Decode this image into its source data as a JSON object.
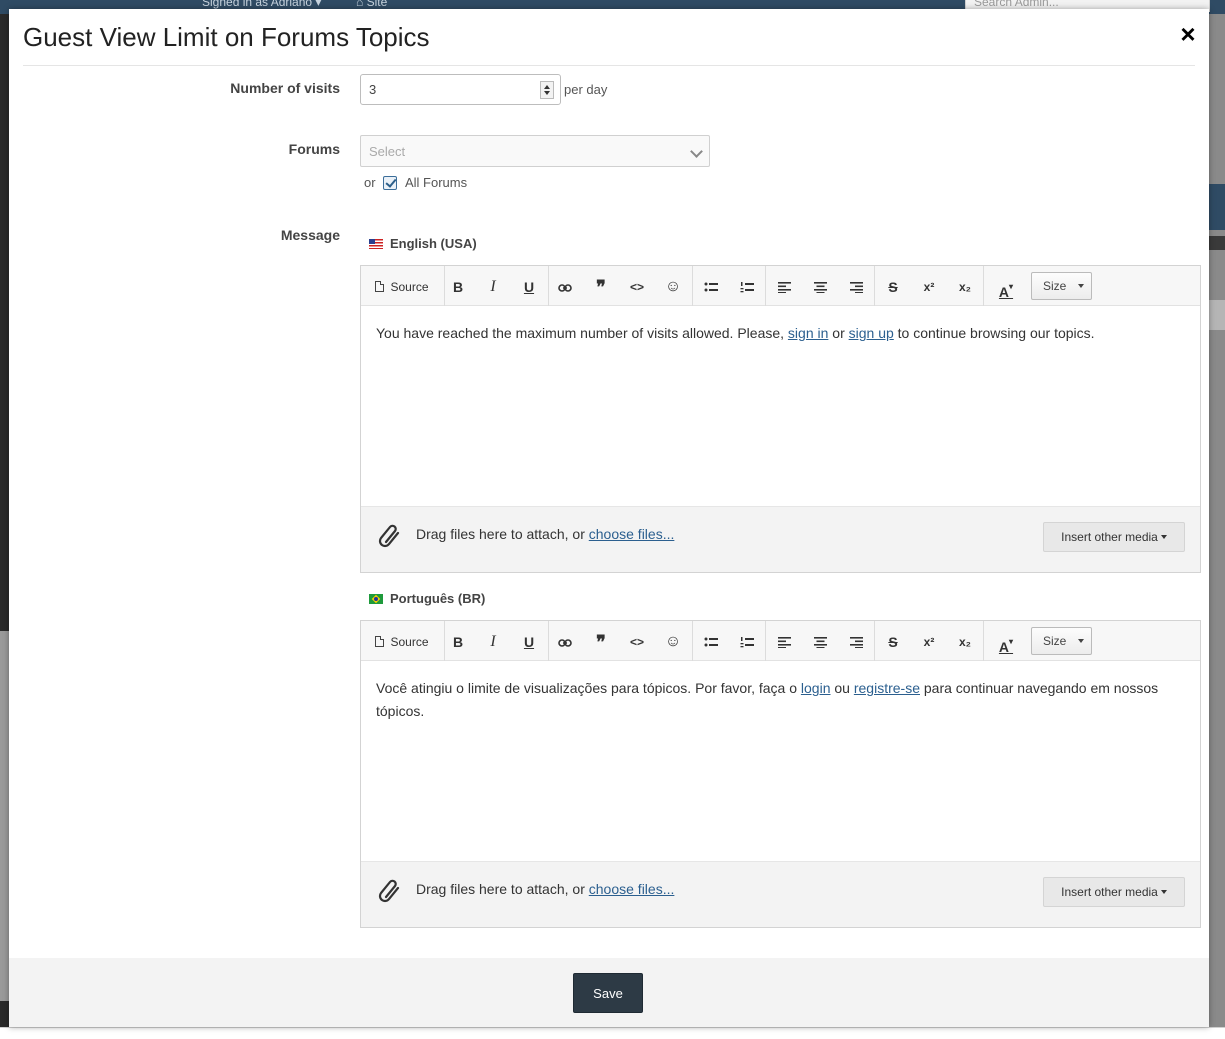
{
  "background": {
    "signed_in_text": "Signed in as Adriano ▾",
    "site_link": "⌂ Site",
    "search_placeholder": "Search Admin..."
  },
  "modal": {
    "title": "Guest View Limit on Forums Topics",
    "close_symbol": "×"
  },
  "form": {
    "visits_label": "Number of visits",
    "visits_value": "3",
    "per_day": "per day",
    "forums_label": "Forums",
    "forums_placeholder": "Select",
    "or_text": "or",
    "all_forums_label": "All Forums",
    "all_forums_checked": true,
    "message_label": "Message"
  },
  "toolbar": {
    "source_label": "Source",
    "bold": "B",
    "italic": "I",
    "underline": "U",
    "quote": "❞",
    "code": "<>",
    "emoji": "☺",
    "strike": "S",
    "superscript": "x²",
    "subscript": "x₂",
    "font_color": "A",
    "size_label": "Size"
  },
  "editors": [
    {
      "language": "English (USA)",
      "text_before": "You have reached the maximum number of visits allowed. Please, ",
      "link1": "sign in",
      "text_middle": " or ",
      "link2": "sign up",
      "text_after": " to continue browsing our topics."
    },
    {
      "language": "Português (BR)",
      "text_before": "Você atingiu o limite de visualizações para tópicos. Por favor, faça o ",
      "link1": "login",
      "text_middle": " ou ",
      "link2": "registre-se",
      "text_after": " para continuar navegando em nossos tópicos."
    }
  ],
  "attach": {
    "text": "Drag files here to attach, or ",
    "link": "choose files...",
    "insert_media": "Insert other media"
  },
  "footer": {
    "save_label": "Save"
  },
  "colors": {
    "link": "#2b5f8f",
    "save_button": "#2d3a45",
    "header_bar": "#2f4b64"
  }
}
